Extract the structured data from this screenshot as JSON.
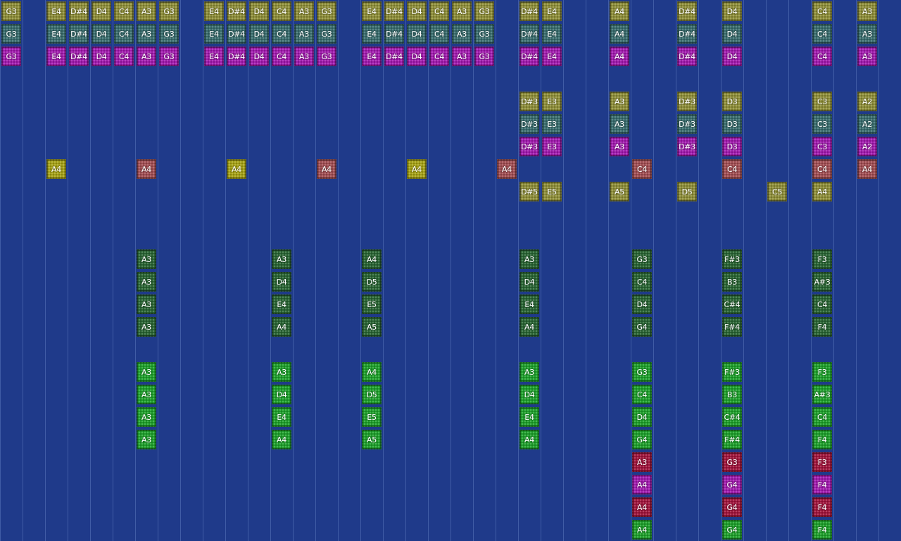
{
  "palette": {
    "olive": "#8f8f3a",
    "teal": "#3a6d6e",
    "magenta": "#a21caf",
    "yellow": "#a6a217",
    "rose": "#a24f54",
    "dkgreen": "#2a6534",
    "green": "#1fa02c",
    "crimson": "#a1163d"
  },
  "sequencer": {
    "columns": 40,
    "rows": 24,
    "notes": [
      {
        "col": 0,
        "row": 0,
        "label": "G3",
        "color": "olive"
      },
      {
        "col": 0,
        "row": 1,
        "label": "G3",
        "color": "teal"
      },
      {
        "col": 0,
        "row": 2,
        "label": "G3",
        "color": "magenta"
      },
      {
        "col": 2,
        "row": 0,
        "label": "E4",
        "color": "olive"
      },
      {
        "col": 3,
        "row": 0,
        "label": "D#4",
        "color": "olive"
      },
      {
        "col": 4,
        "row": 0,
        "label": "D4",
        "color": "olive"
      },
      {
        "col": 5,
        "row": 0,
        "label": "C4",
        "color": "olive"
      },
      {
        "col": 6,
        "row": 0,
        "label": "A3",
        "color": "olive"
      },
      {
        "col": 7,
        "row": 0,
        "label": "G3",
        "color": "olive"
      },
      {
        "col": 2,
        "row": 1,
        "label": "E4",
        "color": "teal"
      },
      {
        "col": 3,
        "row": 1,
        "label": "D#4",
        "color": "teal"
      },
      {
        "col": 4,
        "row": 1,
        "label": "D4",
        "color": "teal"
      },
      {
        "col": 5,
        "row": 1,
        "label": "C4",
        "color": "teal"
      },
      {
        "col": 6,
        "row": 1,
        "label": "A3",
        "color": "teal"
      },
      {
        "col": 7,
        "row": 1,
        "label": "G3",
        "color": "teal"
      },
      {
        "col": 2,
        "row": 2,
        "label": "E4",
        "color": "magenta"
      },
      {
        "col": 3,
        "row": 2,
        "label": "D#4",
        "color": "magenta"
      },
      {
        "col": 4,
        "row": 2,
        "label": "D4",
        "color": "magenta"
      },
      {
        "col": 5,
        "row": 2,
        "label": "C4",
        "color": "magenta"
      },
      {
        "col": 6,
        "row": 2,
        "label": "A3",
        "color": "magenta"
      },
      {
        "col": 7,
        "row": 2,
        "label": "G3",
        "color": "magenta"
      },
      {
        "col": 9,
        "row": 0,
        "label": "E4",
        "color": "olive"
      },
      {
        "col": 10,
        "row": 0,
        "label": "D#4",
        "color": "olive"
      },
      {
        "col": 11,
        "row": 0,
        "label": "D4",
        "color": "olive"
      },
      {
        "col": 12,
        "row": 0,
        "label": "C4",
        "color": "olive"
      },
      {
        "col": 13,
        "row": 0,
        "label": "A3",
        "color": "olive"
      },
      {
        "col": 14,
        "row": 0,
        "label": "G3",
        "color": "olive"
      },
      {
        "col": 9,
        "row": 1,
        "label": "E4",
        "color": "teal"
      },
      {
        "col": 10,
        "row": 1,
        "label": "D#4",
        "color": "teal"
      },
      {
        "col": 11,
        "row": 1,
        "label": "D4",
        "color": "teal"
      },
      {
        "col": 12,
        "row": 1,
        "label": "C4",
        "color": "teal"
      },
      {
        "col": 13,
        "row": 1,
        "label": "A3",
        "color": "teal"
      },
      {
        "col": 14,
        "row": 1,
        "label": "G3",
        "color": "teal"
      },
      {
        "col": 9,
        "row": 2,
        "label": "E4",
        "color": "magenta"
      },
      {
        "col": 10,
        "row": 2,
        "label": "D#4",
        "color": "magenta"
      },
      {
        "col": 11,
        "row": 2,
        "label": "D4",
        "color": "magenta"
      },
      {
        "col": 12,
        "row": 2,
        "label": "C4",
        "color": "magenta"
      },
      {
        "col": 13,
        "row": 2,
        "label": "A3",
        "color": "magenta"
      },
      {
        "col": 14,
        "row": 2,
        "label": "G3",
        "color": "magenta"
      },
      {
        "col": 16,
        "row": 0,
        "label": "E4",
        "color": "olive"
      },
      {
        "col": 17,
        "row": 0,
        "label": "D#4",
        "color": "olive"
      },
      {
        "col": 18,
        "row": 0,
        "label": "D4",
        "color": "olive"
      },
      {
        "col": 19,
        "row": 0,
        "label": "C4",
        "color": "olive"
      },
      {
        "col": 20,
        "row": 0,
        "label": "A3",
        "color": "olive"
      },
      {
        "col": 21,
        "row": 0,
        "label": "G3",
        "color": "olive"
      },
      {
        "col": 16,
        "row": 1,
        "label": "E4",
        "color": "teal"
      },
      {
        "col": 17,
        "row": 1,
        "label": "D#4",
        "color": "teal"
      },
      {
        "col": 18,
        "row": 1,
        "label": "D4",
        "color": "teal"
      },
      {
        "col": 19,
        "row": 1,
        "label": "C4",
        "color": "teal"
      },
      {
        "col": 20,
        "row": 1,
        "label": "A3",
        "color": "teal"
      },
      {
        "col": 21,
        "row": 1,
        "label": "G3",
        "color": "teal"
      },
      {
        "col": 16,
        "row": 2,
        "label": "E4",
        "color": "magenta"
      },
      {
        "col": 17,
        "row": 2,
        "label": "D#4",
        "color": "magenta"
      },
      {
        "col": 18,
        "row": 2,
        "label": "D4",
        "color": "magenta"
      },
      {
        "col": 19,
        "row": 2,
        "label": "C4",
        "color": "magenta"
      },
      {
        "col": 20,
        "row": 2,
        "label": "A3",
        "color": "magenta"
      },
      {
        "col": 21,
        "row": 2,
        "label": "G3",
        "color": "magenta"
      },
      {
        "col": 23,
        "row": 0,
        "label": "D#4",
        "color": "olive"
      },
      {
        "col": 24,
        "row": 0,
        "label": "E4",
        "color": "olive"
      },
      {
        "col": 23,
        "row": 1,
        "label": "D#4",
        "color": "teal"
      },
      {
        "col": 24,
        "row": 1,
        "label": "E4",
        "color": "teal"
      },
      {
        "col": 23,
        "row": 2,
        "label": "D#4",
        "color": "magenta"
      },
      {
        "col": 24,
        "row": 2,
        "label": "E4",
        "color": "magenta"
      },
      {
        "col": 27,
        "row": 0,
        "label": "A4",
        "color": "olive"
      },
      {
        "col": 27,
        "row": 1,
        "label": "A4",
        "color": "teal"
      },
      {
        "col": 27,
        "row": 2,
        "label": "A4",
        "color": "magenta"
      },
      {
        "col": 30,
        "row": 0,
        "label": "D#4",
        "color": "olive"
      },
      {
        "col": 30,
        "row": 1,
        "label": "D#4",
        "color": "teal"
      },
      {
        "col": 30,
        "row": 2,
        "label": "D#4",
        "color": "magenta"
      },
      {
        "col": 32,
        "row": 0,
        "label": "D4",
        "color": "olive"
      },
      {
        "col": 32,
        "row": 1,
        "label": "D4",
        "color": "teal"
      },
      {
        "col": 32,
        "row": 2,
        "label": "D4",
        "color": "magenta"
      },
      {
        "col": 36,
        "row": 0,
        "label": "C4",
        "color": "olive"
      },
      {
        "col": 36,
        "row": 1,
        "label": "C4",
        "color": "teal"
      },
      {
        "col": 36,
        "row": 2,
        "label": "C4",
        "color": "magenta"
      },
      {
        "col": 38,
        "row": 0,
        "label": "A3",
        "color": "olive"
      },
      {
        "col": 38,
        "row": 1,
        "label": "A3",
        "color": "teal"
      },
      {
        "col": 38,
        "row": 2,
        "label": "A3",
        "color": "magenta"
      },
      {
        "col": 23,
        "row": 4,
        "label": "D#3",
        "color": "olive"
      },
      {
        "col": 24,
        "row": 4,
        "label": "E3",
        "color": "olive"
      },
      {
        "col": 23,
        "row": 5,
        "label": "D#3",
        "color": "teal"
      },
      {
        "col": 24,
        "row": 5,
        "label": "E3",
        "color": "teal"
      },
      {
        "col": 23,
        "row": 6,
        "label": "D#3",
        "color": "magenta"
      },
      {
        "col": 24,
        "row": 6,
        "label": "E3",
        "color": "magenta"
      },
      {
        "col": 27,
        "row": 4,
        "label": "A3",
        "color": "olive"
      },
      {
        "col": 27,
        "row": 5,
        "label": "A3",
        "color": "teal"
      },
      {
        "col": 27,
        "row": 6,
        "label": "A3",
        "color": "magenta"
      },
      {
        "col": 30,
        "row": 4,
        "label": "D#3",
        "color": "olive"
      },
      {
        "col": 30,
        "row": 5,
        "label": "D#3",
        "color": "teal"
      },
      {
        "col": 30,
        "row": 6,
        "label": "D#3",
        "color": "magenta"
      },
      {
        "col": 32,
        "row": 4,
        "label": "D3",
        "color": "olive"
      },
      {
        "col": 32,
        "row": 5,
        "label": "D3",
        "color": "teal"
      },
      {
        "col": 32,
        "row": 6,
        "label": "D3",
        "color": "magenta"
      },
      {
        "col": 36,
        "row": 4,
        "label": "C3",
        "color": "olive"
      },
      {
        "col": 36,
        "row": 5,
        "label": "C3",
        "color": "teal"
      },
      {
        "col": 36,
        "row": 6,
        "label": "C3",
        "color": "magenta"
      },
      {
        "col": 38,
        "row": 4,
        "label": "A2",
        "color": "olive"
      },
      {
        "col": 38,
        "row": 5,
        "label": "A2",
        "color": "teal"
      },
      {
        "col": 38,
        "row": 6,
        "label": "A2",
        "color": "magenta"
      },
      {
        "col": 2,
        "row": 7,
        "label": "A4",
        "color": "yellow"
      },
      {
        "col": 6,
        "row": 7,
        "label": "A4",
        "color": "rose"
      },
      {
        "col": 10,
        "row": 7,
        "label": "A4",
        "color": "yellow"
      },
      {
        "col": 14,
        "row": 7,
        "label": "A4",
        "color": "rose"
      },
      {
        "col": 18,
        "row": 7,
        "label": "A4",
        "color": "yellow"
      },
      {
        "col": 22,
        "row": 7,
        "label": "A4",
        "color": "rose"
      },
      {
        "col": 28,
        "row": 7,
        "label": "C4",
        "color": "rose"
      },
      {
        "col": 32,
        "row": 7,
        "label": "C4",
        "color": "rose"
      },
      {
        "col": 36,
        "row": 7,
        "label": "C4",
        "color": "rose"
      },
      {
        "col": 38,
        "row": 7,
        "label": "A4",
        "color": "rose"
      },
      {
        "col": 23,
        "row": 8,
        "label": "D#5",
        "color": "olive"
      },
      {
        "col": 24,
        "row": 8,
        "label": "E5",
        "color": "olive"
      },
      {
        "col": 27,
        "row": 8,
        "label": "A5",
        "color": "olive"
      },
      {
        "col": 30,
        "row": 8,
        "label": "D5",
        "color": "olive"
      },
      {
        "col": 34,
        "row": 8,
        "label": "C5",
        "color": "olive"
      },
      {
        "col": 36,
        "row": 8,
        "label": "A4",
        "color": "olive"
      },
      {
        "col": 6,
        "row": 11,
        "label": "A3",
        "color": "dkgreen"
      },
      {
        "col": 6,
        "row": 12,
        "label": "A3",
        "color": "dkgreen"
      },
      {
        "col": 6,
        "row": 13,
        "label": "A3",
        "color": "dkgreen"
      },
      {
        "col": 6,
        "row": 14,
        "label": "A3",
        "color": "dkgreen"
      },
      {
        "col": 12,
        "row": 11,
        "label": "A3",
        "color": "dkgreen"
      },
      {
        "col": 12,
        "row": 12,
        "label": "D4",
        "color": "dkgreen"
      },
      {
        "col": 12,
        "row": 13,
        "label": "E4",
        "color": "dkgreen"
      },
      {
        "col": 12,
        "row": 14,
        "label": "A4",
        "color": "dkgreen"
      },
      {
        "col": 16,
        "row": 11,
        "label": "A4",
        "color": "dkgreen"
      },
      {
        "col": 16,
        "row": 12,
        "label": "D5",
        "color": "dkgreen"
      },
      {
        "col": 16,
        "row": 13,
        "label": "E5",
        "color": "dkgreen"
      },
      {
        "col": 16,
        "row": 14,
        "label": "A5",
        "color": "dkgreen"
      },
      {
        "col": 23,
        "row": 11,
        "label": "A3",
        "color": "dkgreen"
      },
      {
        "col": 23,
        "row": 12,
        "label": "D4",
        "color": "dkgreen"
      },
      {
        "col": 23,
        "row": 13,
        "label": "E4",
        "color": "dkgreen"
      },
      {
        "col": 23,
        "row": 14,
        "label": "A4",
        "color": "dkgreen"
      },
      {
        "col": 28,
        "row": 11,
        "label": "G3",
        "color": "dkgreen"
      },
      {
        "col": 28,
        "row": 12,
        "label": "C4",
        "color": "dkgreen"
      },
      {
        "col": 28,
        "row": 13,
        "label": "D4",
        "color": "dkgreen"
      },
      {
        "col": 28,
        "row": 14,
        "label": "G4",
        "color": "dkgreen"
      },
      {
        "col": 32,
        "row": 11,
        "label": "F#3",
        "color": "dkgreen"
      },
      {
        "col": 32,
        "row": 12,
        "label": "B3",
        "color": "dkgreen"
      },
      {
        "col": 32,
        "row": 13,
        "label": "C#4",
        "color": "dkgreen"
      },
      {
        "col": 32,
        "row": 14,
        "label": "F#4",
        "color": "dkgreen"
      },
      {
        "col": 36,
        "row": 11,
        "label": "F3",
        "color": "dkgreen"
      },
      {
        "col": 36,
        "row": 12,
        "label": "A#3",
        "color": "dkgreen"
      },
      {
        "col": 36,
        "row": 13,
        "label": "C4",
        "color": "dkgreen"
      },
      {
        "col": 36,
        "row": 14,
        "label": "F4",
        "color": "dkgreen"
      },
      {
        "col": 6,
        "row": 16,
        "label": "A3",
        "color": "green"
      },
      {
        "col": 6,
        "row": 17,
        "label": "A3",
        "color": "green"
      },
      {
        "col": 6,
        "row": 18,
        "label": "A3",
        "color": "green"
      },
      {
        "col": 6,
        "row": 19,
        "label": "A3",
        "color": "green"
      },
      {
        "col": 12,
        "row": 16,
        "label": "A3",
        "color": "green"
      },
      {
        "col": 12,
        "row": 17,
        "label": "D4",
        "color": "green"
      },
      {
        "col": 12,
        "row": 18,
        "label": "E4",
        "color": "green"
      },
      {
        "col": 12,
        "row": 19,
        "label": "A4",
        "color": "green"
      },
      {
        "col": 16,
        "row": 16,
        "label": "A4",
        "color": "green"
      },
      {
        "col": 16,
        "row": 17,
        "label": "D5",
        "color": "green"
      },
      {
        "col": 16,
        "row": 18,
        "label": "E5",
        "color": "green"
      },
      {
        "col": 16,
        "row": 19,
        "label": "A5",
        "color": "green"
      },
      {
        "col": 23,
        "row": 16,
        "label": "A3",
        "color": "green"
      },
      {
        "col": 23,
        "row": 17,
        "label": "D4",
        "color": "green"
      },
      {
        "col": 23,
        "row": 18,
        "label": "E4",
        "color": "green"
      },
      {
        "col": 23,
        "row": 19,
        "label": "A4",
        "color": "green"
      },
      {
        "col": 28,
        "row": 16,
        "label": "G3",
        "color": "green"
      },
      {
        "col": 28,
        "row": 17,
        "label": "C4",
        "color": "green"
      },
      {
        "col": 28,
        "row": 18,
        "label": "D4",
        "color": "green"
      },
      {
        "col": 28,
        "row": 19,
        "label": "G4",
        "color": "green"
      },
      {
        "col": 32,
        "row": 16,
        "label": "F#3",
        "color": "green"
      },
      {
        "col": 32,
        "row": 17,
        "label": "B3",
        "color": "green"
      },
      {
        "col": 32,
        "row": 18,
        "label": "C#4",
        "color": "green"
      },
      {
        "col": 32,
        "row": 19,
        "label": "F#4",
        "color": "green"
      },
      {
        "col": 36,
        "row": 16,
        "label": "F3",
        "color": "green"
      },
      {
        "col": 36,
        "row": 17,
        "label": "A#3",
        "color": "green"
      },
      {
        "col": 36,
        "row": 18,
        "label": "C4",
        "color": "green"
      },
      {
        "col": 36,
        "row": 19,
        "label": "F4",
        "color": "green"
      },
      {
        "col": 28,
        "row": 20,
        "label": "A3",
        "color": "crimson"
      },
      {
        "col": 28,
        "row": 21,
        "label": "A4",
        "color": "magenta"
      },
      {
        "col": 28,
        "row": 22,
        "label": "A4",
        "color": "crimson"
      },
      {
        "col": 28,
        "row": 23,
        "label": "A4",
        "color": "green"
      },
      {
        "col": 32,
        "row": 20,
        "label": "G3",
        "color": "crimson"
      },
      {
        "col": 32,
        "row": 21,
        "label": "G4",
        "color": "magenta"
      },
      {
        "col": 32,
        "row": 22,
        "label": "G4",
        "color": "crimson"
      },
      {
        "col": 32,
        "row": 23,
        "label": "G4",
        "color": "green"
      },
      {
        "col": 36,
        "row": 20,
        "label": "F3",
        "color": "crimson"
      },
      {
        "col": 36,
        "row": 21,
        "label": "F4",
        "color": "magenta"
      },
      {
        "col": 36,
        "row": 22,
        "label": "F4",
        "color": "crimson"
      },
      {
        "col": 36,
        "row": 23,
        "label": "F4",
        "color": "green"
      }
    ]
  }
}
